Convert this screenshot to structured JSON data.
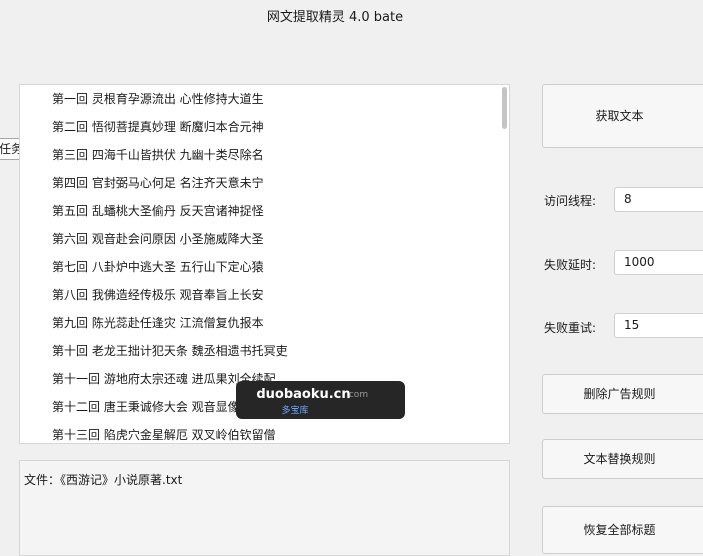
{
  "window": {
    "title": "网文提取精灵 4.0 bate"
  },
  "task_tab": {
    "label": "任务"
  },
  "chapters": [
    "第一回 灵根育孕源流出 心性修持大道生",
    "第二回 悟彻菩提真妙理 断魔归本合元神",
    "第三回 四海千山皆拱伏 九幽十类尽除名",
    "第四回 官封弼马心何足 名注齐天意未宁",
    "第五回 乱蟠桃大圣偷丹 反天宫诸神捉怪",
    "第六回 观音赴会问原因 小圣施威降大圣",
    "第七回 八卦炉中逃大圣 五行山下定心猿",
    "第八回 我佛造经传极乐 观音奉旨上长安",
    "第九回 陈光蕊赴任逢灾 江流僧复仇报本",
    "第十回 老龙王拙计犯天条 魏丞相遗书托冥吏",
    "第十一回 游地府太宗还魂 进瓜果刘全续配",
    "第十二回 唐王秉诚修大会 观音显像化金蝉",
    "第十三回 陷虎穴金星解厄 双叉岭伯钦留僧"
  ],
  "file": {
    "line": "文件：《西游记》小说原著.txt"
  },
  "buttons": {
    "fetch": "获取文本",
    "delete_ad_rules": "删除广告规则",
    "text_replace_rules": "文本替换规则",
    "restore_titles": "恢复全部标题"
  },
  "settings": {
    "threads_label": "访问线程:",
    "threads_value": "8",
    "fail_delay_label": "失败延时:",
    "fail_delay_value": "1000",
    "fail_retry_label": "失败重试:",
    "fail_retry_value": "15"
  },
  "watermark": {
    "main": "duobaoku.cn",
    "com": ".com",
    "sub": "多宝库"
  }
}
